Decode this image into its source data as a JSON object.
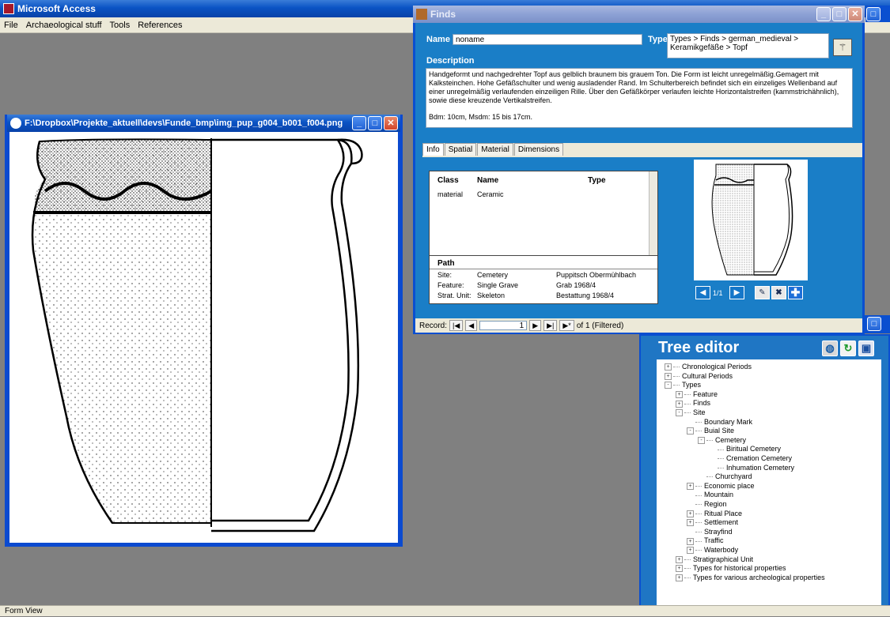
{
  "main": {
    "title": "Microsoft Access",
    "menu": [
      "File",
      "Archaeological stuff",
      "Tools",
      "References"
    ],
    "status": "Form View"
  },
  "viewer": {
    "title": "F:\\Dropbox\\Projekte_aktuell\\devs\\Funde_bmp\\img_pup_g004_b001_f004.png"
  },
  "finds": {
    "title": "Finds",
    "name_label": "Name",
    "name_value": "noname",
    "type_label": "Type",
    "type_value": "Types > Finds > german_medieval > Keramikgefäße > Topf",
    "description_label": "Description",
    "description_text": "Handgeformt und nachgedrehter Topf aus gelblich braunem bis grauem Ton. Die Form ist leicht unregelmäßig.Gemagert mit Kalksteinchen. Hohe Gefäßschulter und wenig ausladender Rand. Im Schulterbereich befindet sich ein einzeliges Wellenband auf einer unregelmäßig verlaufenden einzeiligen Rille. Über den Gefäßkörper verlaufen leichte Horizontalstreifen (kammstrichähnlich), sowie diese kreuzende Vertikalstreifen.",
    "description_dims": "Bdm: 10cm, Msdm: 15 bis 17cm.",
    "tabs": [
      "Info",
      "Spatial",
      "Material",
      "Dimensions"
    ],
    "class_table": {
      "headers": [
        "Class",
        "Name",
        "Type"
      ],
      "rows": [
        [
          "material",
          "Ceramic",
          ""
        ]
      ]
    },
    "path": {
      "title": "Path",
      "rows": [
        {
          "label": "Site:",
          "name": "Cemetery",
          "value": "Puppitsch Obermühlbach"
        },
        {
          "label": "Feature:",
          "name": "Single Grave",
          "value": "Grab 1968/4"
        },
        {
          "label": "Strat. Unit:",
          "name": "Skeleton",
          "value": "Bestattung 1968/4"
        }
      ]
    },
    "image_counter": "1/1",
    "record": {
      "label": "Record:",
      "current": "1",
      "total_text": "of 1 (Filtered)"
    }
  },
  "tree": {
    "title": "Tree editor",
    "nodes": [
      {
        "label": "Chronological Periods",
        "level": 0,
        "toggle": "+"
      },
      {
        "label": "Cultural Periods",
        "level": 0,
        "toggle": "+"
      },
      {
        "label": "Types",
        "level": 0,
        "toggle": "-"
      },
      {
        "label": "Feature",
        "level": 1,
        "toggle": "+"
      },
      {
        "label": "Finds",
        "level": 1,
        "toggle": "+"
      },
      {
        "label": "Site",
        "level": 1,
        "toggle": "-"
      },
      {
        "label": "Boundary Mark",
        "level": 2,
        "toggle": ""
      },
      {
        "label": "Buial Site",
        "level": 2,
        "toggle": "-"
      },
      {
        "label": "Cemetery",
        "level": 3,
        "toggle": "-"
      },
      {
        "label": "Biritual Cemetery",
        "level": 4,
        "toggle": ""
      },
      {
        "label": "Cremation Cemetery",
        "level": 4,
        "toggle": ""
      },
      {
        "label": "Inhumation Cemetery",
        "level": 4,
        "toggle": ""
      },
      {
        "label": "Churchyard",
        "level": 3,
        "toggle": ""
      },
      {
        "label": "Economic place",
        "level": 2,
        "toggle": "+"
      },
      {
        "label": "Mountain",
        "level": 2,
        "toggle": ""
      },
      {
        "label": "Region",
        "level": 2,
        "toggle": ""
      },
      {
        "label": "Ritual Place",
        "level": 2,
        "toggle": "+"
      },
      {
        "label": "Settlement",
        "level": 2,
        "toggle": "+"
      },
      {
        "label": "Strayfind",
        "level": 2,
        "toggle": ""
      },
      {
        "label": "Traffic",
        "level": 2,
        "toggle": "+"
      },
      {
        "label": "Waterbody",
        "level": 2,
        "toggle": "+"
      },
      {
        "label": "Stratigraphical Unit",
        "level": 1,
        "toggle": "+"
      },
      {
        "label": "Types for historical properties",
        "level": 1,
        "toggle": "+"
      },
      {
        "label": "Types for various archeological properties",
        "level": 1,
        "toggle": "+"
      }
    ]
  },
  "icons": {
    "globe": "globe-icon",
    "refresh": "refresh-icon",
    "save": "save-icon",
    "wand": "magic-wand-icon",
    "pencil": "pencil-icon",
    "delete": "delete-icon",
    "add": "add-icon"
  },
  "colors": {
    "xp_blue": "#0a4fd0",
    "form_blue": "#1a7ec7",
    "desktop_gray": "#808080"
  }
}
